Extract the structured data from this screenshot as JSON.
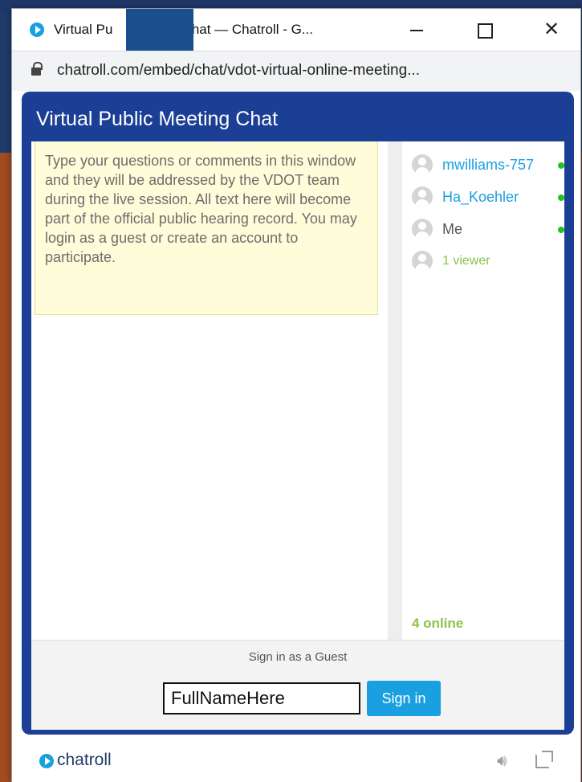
{
  "window": {
    "title_prefix": "Virtual Pu",
    "title_suffix": "ting Chat — Chatroll - G...",
    "minimize_label": "",
    "maximize_label": "",
    "close_label": "✕"
  },
  "address": {
    "url": "chatroll.com/embed/chat/vdot-virtual-online-meeting..."
  },
  "chat": {
    "title": "Virtual Public Meeting Chat",
    "notice": "Type your questions or comments in this window and they will be addressed by the VDOT team during the live session. All text here will become part of the official public hearing record. You may login as a guest or create an account to participate.",
    "users": [
      {
        "name": "mwilliams-757",
        "online": true
      },
      {
        "name": "Ha_Koehler",
        "online": true
      },
      {
        "name": "Me",
        "online": true
      },
      {
        "name": "1 viewer",
        "online": false
      }
    ],
    "online_count": "4 online"
  },
  "signin": {
    "label": "Sign in as a Guest",
    "input_value": "FullNameHere",
    "button_label": "Sign in"
  },
  "footer": {
    "brand": "chatroll",
    "sound_icon": "sound-icon",
    "popout_icon": "popout-icon"
  },
  "colors": {
    "frame_blue": "#1b3f95",
    "accent": "#1a9fe0",
    "online_green": "#22c322",
    "viewer_green": "#8bc34a",
    "notice_bg": "#fefcd9"
  }
}
